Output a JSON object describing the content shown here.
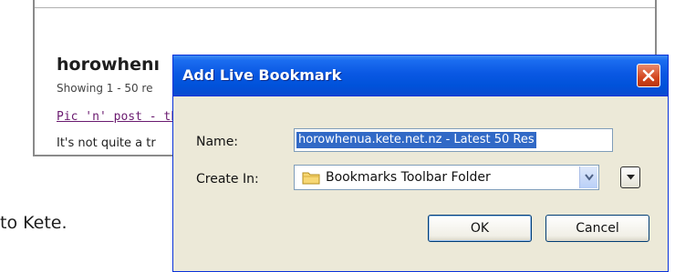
{
  "background_page": {
    "site_title": "horowhenı",
    "results_text": "Showing 1 - 50 re",
    "result_link": "Pic 'n' post - th",
    "result_snippet": "It's not quite a tr",
    "caption": "to Kete."
  },
  "dialog": {
    "title": "Add Live Bookmark",
    "close_icon": "close-icon",
    "name_label": "Name:",
    "name_value": "horowhenua.kete.net.nz - Latest 50 Res",
    "create_in_label": "Create In:",
    "create_in_value": "Bookmarks Toolbar Folder",
    "folder_icon": "folder-icon",
    "ok_label": "OK",
    "cancel_label": "Cancel"
  },
  "colors": {
    "titlebar_blue": "#0a58e3",
    "close_red": "#d3461f",
    "dialog_face": "#ece9d8",
    "selection_blue": "#3169c6",
    "link_purple": "#6a1a6f"
  }
}
